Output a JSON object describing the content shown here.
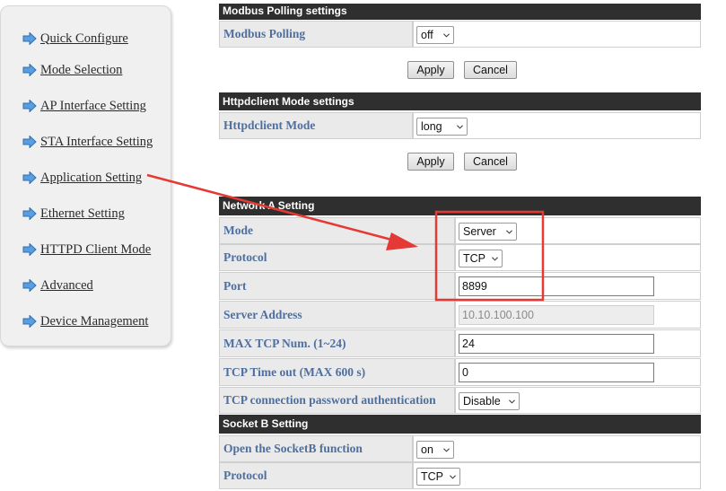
{
  "sidebar": {
    "items": [
      {
        "label": "Quick Configure"
      },
      {
        "label": "Mode Selection"
      },
      {
        "label": "AP Interface Setting"
      },
      {
        "label": "STA Interface Setting"
      },
      {
        "label": "Application Setting"
      },
      {
        "label": "Ethernet Setting"
      },
      {
        "label": "HTTPD Client Mode"
      },
      {
        "label": "Advanced"
      },
      {
        "label": "Device Management"
      }
    ]
  },
  "modbus": {
    "title": "Modbus Polling settings",
    "label": "Modbus Polling",
    "value": "off",
    "apply": "Apply",
    "cancel": "Cancel"
  },
  "httpd": {
    "title": "Httpdclient Mode settings",
    "label": "Httpdclient Mode",
    "value": "long",
    "apply": "Apply",
    "cancel": "Cancel"
  },
  "network_a": {
    "title": "Network A Setting",
    "mode": {
      "label": "Mode",
      "value": "Server"
    },
    "protocol": {
      "label": "Protocol",
      "value": "TCP"
    },
    "port": {
      "label": "Port",
      "value": "8899"
    },
    "server_address": {
      "label": "Server Address",
      "value": "10.10.100.100"
    },
    "max_tcp": {
      "label": "MAX TCP Num. (1~24)",
      "value": "24"
    },
    "tcp_timeout": {
      "label": "TCP Time out (MAX 600 s)",
      "value": "0"
    },
    "tcp_auth": {
      "label": "TCP connection password authentication",
      "value": "Disable"
    }
  },
  "socket_b": {
    "title": "Socket B Setting",
    "open": {
      "label": "Open the SocketB function",
      "value": "on"
    },
    "protocol": {
      "label": "Protocol",
      "value": "TCP"
    }
  },
  "colors": {
    "label_text": "#4f6f9f",
    "header_bar": "#2f2f2f",
    "annotation": "#e53935",
    "nav_arrow": "#3b82c4"
  }
}
